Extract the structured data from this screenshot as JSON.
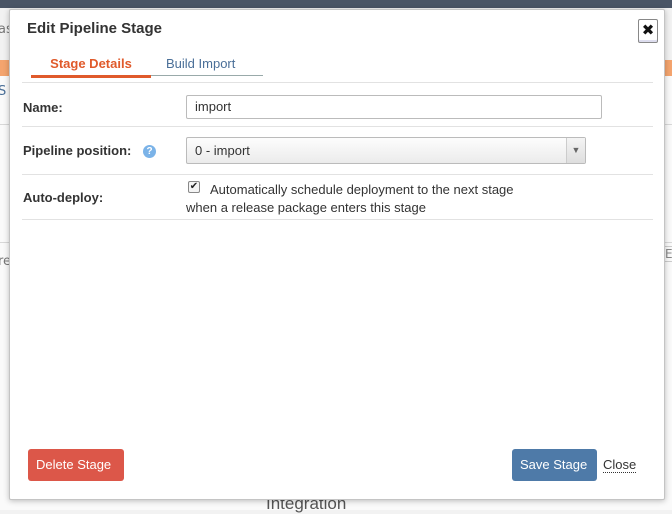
{
  "background": {
    "left_fragment_1": "as",
    "left_fragment_2": "S",
    "left_fragment_3": "re",
    "right_fragment": "E",
    "section_heading": "Integration"
  },
  "modal": {
    "title": "Edit Pipeline Stage",
    "close_glyph": "✖",
    "tabs": [
      {
        "label": "Stage Details",
        "active": true
      },
      {
        "label": "Build Import",
        "active": false
      }
    ],
    "fields": {
      "name_label": "Name:",
      "name_value": "import",
      "position_label": "Pipeline position:",
      "position_value": "0 - import",
      "autodeploy_label": "Auto-deploy:",
      "autodeploy_checked": true,
      "autodeploy_text_line1": "Automatically schedule deployment to the next stage",
      "autodeploy_text_line2": "when a release package enters this stage"
    },
    "buttons": {
      "delete": "Delete Stage",
      "save": "Save Stage",
      "close": "Close"
    }
  },
  "colors": {
    "accent_orange": "#e05a2b",
    "delete_red": "#dc5749",
    "save_blue": "#4e7aa8",
    "help_blue": "#7bb3e8"
  },
  "icons": {
    "help": "help-icon",
    "close": "close-icon",
    "dropdown": "chevron-down-icon",
    "checkbox": "checkbox-checked-icon"
  }
}
